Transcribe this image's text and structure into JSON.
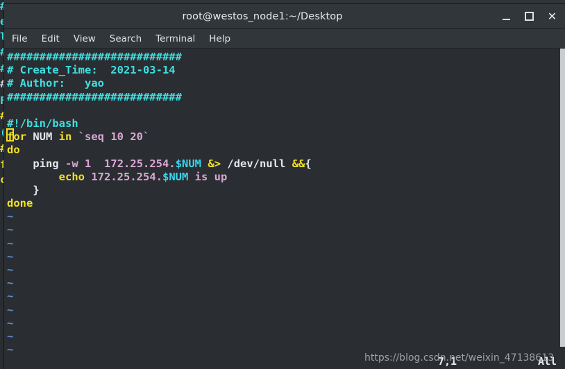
{
  "background_window": {
    "visible_fragment_lines": [
      "#",
      "e",
      "l",
      "#",
      "#",
      "#",
      "F",
      "#",
      "(",
      "#",
      "f",
      "c"
    ]
  },
  "window": {
    "title": "root@westos_node1:~/Desktop",
    "buttons": {
      "minimize": "minimize-icon",
      "maximize": "maximize-icon",
      "close": "✕"
    }
  },
  "menubar": {
    "items": [
      {
        "label": "File"
      },
      {
        "label": "Edit"
      },
      {
        "label": "View"
      },
      {
        "label": "Search"
      },
      {
        "label": "Terminal"
      },
      {
        "label": "Help"
      }
    ]
  },
  "editor": {
    "lines": [
      {
        "segments": [
          {
            "text": "###########################",
            "color": "comment"
          }
        ]
      },
      {
        "segments": [
          {
            "text": "# Create_Time:  2021-03-14",
            "color": "comment"
          }
        ]
      },
      {
        "segments": [
          {
            "text": "# Author:   yao",
            "color": "comment"
          }
        ]
      },
      {
        "segments": [
          {
            "text": "###########################",
            "color": "comment"
          }
        ]
      },
      {
        "segments": [
          {
            "text": "",
            "color": "plain"
          }
        ]
      },
      {
        "segments": [
          {
            "text": "#!/bin/bash",
            "color": "comment"
          }
        ]
      },
      {
        "segments": [
          {
            "text": "for",
            "color": "keyword"
          },
          {
            "text": " NUM ",
            "color": "plain"
          },
          {
            "text": "in",
            "color": "keyword"
          },
          {
            "text": " ",
            "color": "plain"
          },
          {
            "text": "`seq 10 20`",
            "color": "string"
          }
        ]
      },
      {
        "segments": [
          {
            "text": "do",
            "color": "keyword"
          }
        ]
      },
      {
        "segments": [
          {
            "text": "    ping ",
            "color": "plain"
          },
          {
            "text": "-w",
            "color": "string"
          },
          {
            "text": " ",
            "color": "plain"
          },
          {
            "text": "1",
            "color": "num"
          },
          {
            "text": "  ",
            "color": "plain"
          },
          {
            "text": "172.25.254.",
            "color": "string"
          },
          {
            "text": "$NUM",
            "color": "var"
          },
          {
            "text": " ",
            "color": "plain"
          },
          {
            "text": "&>",
            "color": "keyword"
          },
          {
            "text": " /dev/null ",
            "color": "plain"
          },
          {
            "text": "&&",
            "color": "keyword"
          },
          {
            "text": "{",
            "color": "plain"
          }
        ]
      },
      {
        "segments": [
          {
            "text": "        ",
            "color": "plain"
          },
          {
            "text": "echo",
            "color": "keyword"
          },
          {
            "text": " ",
            "color": "plain"
          },
          {
            "text": "172.25.254.",
            "color": "string"
          },
          {
            "text": "$NUM",
            "color": "var"
          },
          {
            "text": " is up",
            "color": "string"
          }
        ]
      },
      {
        "segments": [
          {
            "text": "    }",
            "color": "plain"
          }
        ]
      },
      {
        "segments": [
          {
            "text": "done",
            "color": "keyword"
          }
        ]
      },
      {
        "segments": [
          {
            "text": "~",
            "color": "tilde"
          }
        ]
      },
      {
        "segments": [
          {
            "text": "~",
            "color": "tilde"
          }
        ]
      },
      {
        "segments": [
          {
            "text": "~",
            "color": "tilde"
          }
        ]
      },
      {
        "segments": [
          {
            "text": "~",
            "color": "tilde"
          }
        ]
      },
      {
        "segments": [
          {
            "text": "~",
            "color": "tilde"
          }
        ]
      },
      {
        "segments": [
          {
            "text": "~",
            "color": "tilde"
          }
        ]
      },
      {
        "segments": [
          {
            "text": "~",
            "color": "tilde"
          }
        ]
      },
      {
        "segments": [
          {
            "text": "~",
            "color": "tilde"
          }
        ]
      },
      {
        "segments": [
          {
            "text": "~",
            "color": "tilde"
          }
        ]
      },
      {
        "segments": [
          {
            "text": "~",
            "color": "tilde"
          }
        ]
      },
      {
        "segments": [
          {
            "text": "~",
            "color": "tilde"
          }
        ]
      }
    ],
    "cursor": {
      "line": 7,
      "column": 1
    }
  },
  "statusline": {
    "position": "7,1",
    "scroll_indicator": "All"
  },
  "watermark": {
    "text": "https://blog.csdn.net/weixin_47138613"
  },
  "colors": {
    "terminal_background": "#2a2e32",
    "titlebar_background": "#31363b",
    "comment": "#3fdfe0",
    "keyword": "#f4e020",
    "variable": "#37d6ef",
    "string": "#d9a6d4",
    "plain_text": "#e3e6ea",
    "tilde": "#5f8fd4",
    "scrollbar": "#c9ccd0",
    "cursor_outline": "#f4e020"
  }
}
